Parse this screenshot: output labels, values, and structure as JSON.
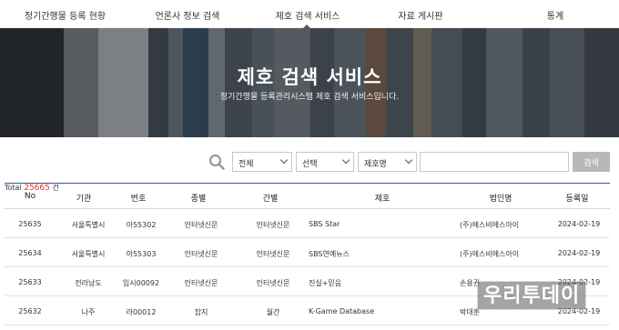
{
  "nav": {
    "items": [
      {
        "label": "정기간행물 등록 현황"
      },
      {
        "label": "언론사 정보 검색"
      },
      {
        "label": "제호 검색 서비스"
      },
      {
        "label": "자료 게시판"
      },
      {
        "label": "통계"
      }
    ]
  },
  "hero": {
    "title": "제호 검색 서비스",
    "subtitle": "정기간행물 등록관리시스템 제호 검색 서비스입니다."
  },
  "search": {
    "scope_value": "전체",
    "filter_value": "선택",
    "field_value": "제호명",
    "query_value": "",
    "button_label": "검색",
    "icon": "search-icon"
  },
  "total": {
    "prefix": "Total",
    "count": "25665",
    "suffix": "건"
  },
  "table": {
    "headers": [
      "No",
      "기관",
      "번호",
      "종별",
      "간별",
      "제호",
      "법인명",
      "등록일"
    ],
    "rows": [
      {
        "no": "25635",
        "org": "서울특별시",
        "reg_no": "아55302",
        "kind": "인터넷신문",
        "period": "인터넷신문",
        "title": "SBS Star",
        "corp": "(주)에스비에스아이",
        "date": "2024-02-19"
      },
      {
        "no": "25634",
        "org": "서울특별시",
        "reg_no": "아55303",
        "kind": "인터넷신문",
        "period": "인터넷신문",
        "title": "SBS연예뉴스",
        "corp": "(주)에스비에스아이",
        "date": "2024-02-19"
      },
      {
        "no": "25633",
        "org": "전라남도",
        "reg_no": "임시00092",
        "kind": "인터넷신문",
        "period": "인터넷신문",
        "title": "진실+믿음",
        "corp": "손용권",
        "date": "2024-02-19"
      },
      {
        "no": "25632",
        "org": "나주",
        "reg_no": "라00012",
        "kind": "잡지",
        "period": "월간",
        "title": "K-Game Database",
        "corp": "박대훈",
        "date": "2024-02-19"
      }
    ]
  },
  "watermark": {
    "text": "우리투데이"
  }
}
